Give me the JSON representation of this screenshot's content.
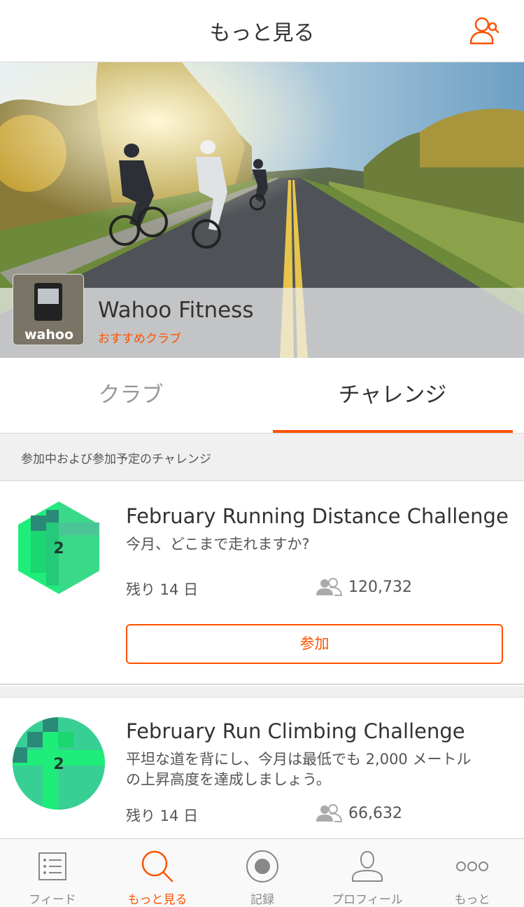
{
  "header": {
    "title": "もっと見る"
  },
  "featured_club": {
    "name": "Wahoo Fitness",
    "subtitle": "おすすめクラブ",
    "thumb_text": "wahoo"
  },
  "tabs": [
    {
      "label": "クラブ",
      "active": false
    },
    {
      "label": "チャレンジ",
      "active": true
    }
  ],
  "section": {
    "title": "参加中および参加予定のチャレンジ"
  },
  "challenges": [
    {
      "title": "February Running Distance Challenge",
      "description": "今月、どこまで走れますか?",
      "days_left": "残り 14 日",
      "participants": "120,732",
      "join_label": "参加",
      "badge_number": "2"
    },
    {
      "title": "February Run Climbing Challenge",
      "description_line1": "平坦な道を背にし、今月は最低でも 2,000 メートル",
      "description_line2": "の上昇高度を達成しましょう。",
      "days_left": "残り 14 日",
      "participants": "66,632",
      "badge_number": "2"
    }
  ],
  "tabbar": [
    {
      "label": "フィード",
      "icon": "feed-list-icon",
      "active": false
    },
    {
      "label": "もっと見る",
      "icon": "search-icon",
      "active": true
    },
    {
      "label": "記録",
      "icon": "record-icon",
      "active": false
    },
    {
      "label": "プロフィール",
      "icon": "profile-icon",
      "active": false
    },
    {
      "label": "もっと",
      "icon": "more-dots-icon",
      "active": false
    }
  ],
  "colors": {
    "accent": "#fc5200",
    "badge_green": "#1eee79",
    "badge_dark": "#2a8a78"
  }
}
